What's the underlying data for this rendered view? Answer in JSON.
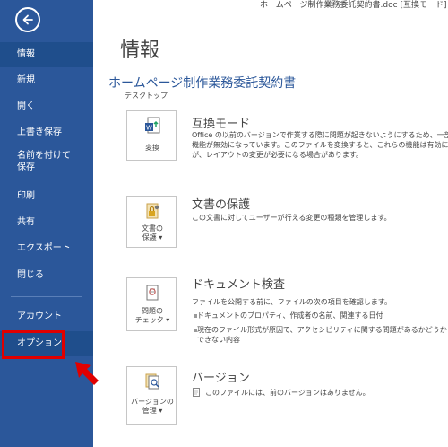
{
  "window": {
    "title": "ホームページ制作業務委託契約書.doc [互換モード] - W"
  },
  "sidebar": {
    "items": [
      {
        "label": "情報"
      },
      {
        "label": "新規"
      },
      {
        "label": "開く"
      },
      {
        "label": "上書き保存"
      },
      {
        "label": "名前を付けて\n保存"
      },
      {
        "label": "印刷"
      },
      {
        "label": "共有"
      },
      {
        "label": "エクスポート"
      },
      {
        "label": "閉じる"
      },
      {
        "label": "アカウント"
      },
      {
        "label": "オプション"
      }
    ]
  },
  "main": {
    "title": "情報",
    "document_title": "ホームページ制作業務委託契約書",
    "location": "デスクトップ",
    "sections": {
      "compat": {
        "button": "変換",
        "title": "互換モード",
        "description": "Office の以前のバージョンで作業する際に問題が起きないようにするため、一部\n機能が無効になっています。このファイルを変換すると、これらの機能は有効になり\nが、レイアウトの変更が必要になる場合があります。"
      },
      "protect": {
        "button": "文書の\n保護 ▾",
        "title": "文書の保護",
        "description": "この文書に対してユーザーが行える変更の種類を管理します。"
      },
      "inspect": {
        "button": "問題の\nチェック ▾",
        "title": "ドキュメント検査",
        "description": "ファイルを公開する前に、ファイルの次の項目を確認します。",
        "bullets": [
          "ドキュメントのプロパティ、作成者の名前、関連する日付",
          "現在のファイル形式が原因で、アクセシビリティに関する問題があるかどうか\nできない内容"
        ]
      },
      "versions": {
        "button": "バージョンの\n管理 ▾",
        "title": "バージョン",
        "description": "このファイルには、前のバージョンはありません。"
      }
    }
  },
  "colors": {
    "sidebar": "#2b579a",
    "accent": "#2b579a",
    "highlight": "#e00000"
  }
}
